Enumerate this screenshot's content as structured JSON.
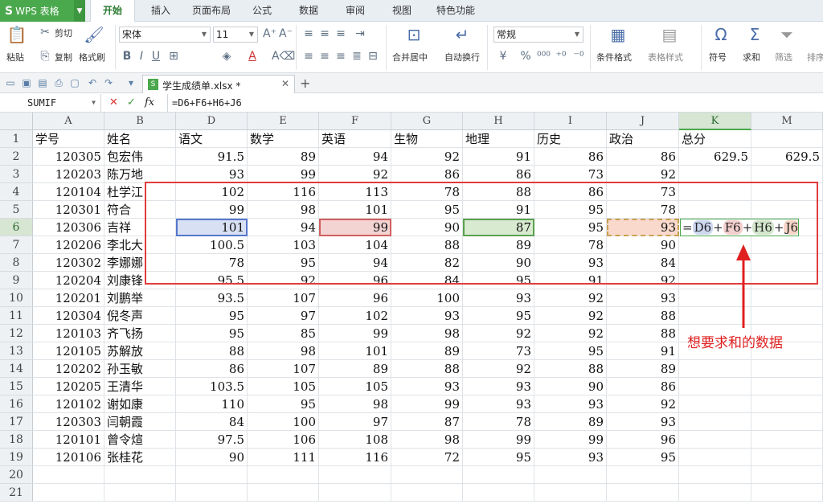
{
  "app": {
    "logo": "S",
    "name": "WPS 表格"
  },
  "menu_tabs": [
    "开始",
    "插入",
    "页面布局",
    "公式",
    "数据",
    "审阅",
    "视图",
    "特色功能"
  ],
  "ribbon": {
    "paste": "粘贴",
    "cut": "剪切",
    "copy": "复制",
    "format_painter": "格式刷",
    "font_name": "宋体",
    "font_size": "11",
    "merge_center": "合并居中",
    "wrap_text": "自动换行",
    "number_format": "常规",
    "conditional_format": "条件格式",
    "table_style": "表格样式",
    "symbol": "符号",
    "sum": "求和",
    "filter": "筛选",
    "sort": "排序"
  },
  "document": {
    "title": "学生成绩单.xlsx *"
  },
  "formula_bar": {
    "name_box": "SUMIF",
    "formula": "=D6+F6+H6+J6",
    "cancel": "✕",
    "confirm": "✓",
    "fx": "fx"
  },
  "columns": [
    "A",
    "B",
    "D",
    "E",
    "F",
    "G",
    "H",
    "I",
    "J",
    "K",
    "M"
  ],
  "selected_column": "K",
  "headers": [
    "学号",
    "姓名",
    "语文",
    "数学",
    "英语",
    "生物",
    "地理",
    "历史",
    "政治",
    "总分",
    ""
  ],
  "rows": [
    [
      "120305",
      "包宏伟",
      "91.5",
      "89",
      "94",
      "92",
      "91",
      "86",
      "86",
      "629.5",
      "629.5"
    ],
    [
      "120203",
      "陈万地",
      "93",
      "99",
      "92",
      "86",
      "86",
      "73",
      "92",
      "",
      ""
    ],
    [
      "120104",
      "杜学江",
      "102",
      "116",
      "113",
      "78",
      "88",
      "86",
      "73",
      "",
      ""
    ],
    [
      "120301",
      "符合",
      "99",
      "98",
      "101",
      "95",
      "91",
      "95",
      "78",
      "",
      ""
    ],
    [
      "120306",
      "吉祥",
      "101",
      "94",
      "99",
      "90",
      "87",
      "95",
      "93",
      "",
      ""
    ],
    [
      "120206",
      "李北大",
      "100.5",
      "103",
      "104",
      "88",
      "89",
      "78",
      "90",
      "",
      ""
    ],
    [
      "120302",
      "李娜娜",
      "78",
      "95",
      "94",
      "82",
      "90",
      "93",
      "84",
      "",
      ""
    ],
    [
      "120204",
      "刘康锋",
      "95.5",
      "92",
      "96",
      "84",
      "95",
      "91",
      "92",
      "",
      ""
    ],
    [
      "120201",
      "刘鹏举",
      "93.5",
      "107",
      "96",
      "100",
      "93",
      "92",
      "93",
      "",
      ""
    ],
    [
      "120304",
      "倪冬声",
      "95",
      "97",
      "102",
      "93",
      "95",
      "92",
      "88",
      "",
      ""
    ],
    [
      "120103",
      "齐飞扬",
      "95",
      "85",
      "99",
      "98",
      "92",
      "92",
      "88",
      "",
      ""
    ],
    [
      "120105",
      "苏解放",
      "88",
      "98",
      "101",
      "89",
      "73",
      "95",
      "91",
      "",
      ""
    ],
    [
      "120202",
      "孙玉敏",
      "86",
      "107",
      "89",
      "88",
      "92",
      "88",
      "89",
      "",
      ""
    ],
    [
      "120205",
      "王清华",
      "103.5",
      "105",
      "105",
      "93",
      "93",
      "90",
      "86",
      "",
      ""
    ],
    [
      "120102",
      "谢如康",
      "110",
      "95",
      "98",
      "99",
      "93",
      "93",
      "92",
      "",
      ""
    ],
    [
      "120303",
      "闫朝霞",
      "84",
      "100",
      "97",
      "87",
      "78",
      "89",
      "93",
      "",
      ""
    ],
    [
      "120101",
      "曾令煊",
      "97.5",
      "106",
      "108",
      "98",
      "99",
      "99",
      "96",
      "",
      ""
    ],
    [
      "120106",
      "张桂花",
      "90",
      "111",
      "116",
      "72",
      "95",
      "93",
      "95",
      "",
      ""
    ],
    [
      "",
      "",
      "",
      "",
      "",
      "",
      "",
      "",
      "",
      "",
      ""
    ],
    [
      "",
      "",
      "",
      "",
      "",
      "",
      "",
      "",
      "",
      "",
      ""
    ]
  ],
  "row_numbers": [
    "1",
    "2",
    "3",
    "4",
    "5",
    "6",
    "7",
    "8",
    "9",
    "10",
    "11",
    "12",
    "13",
    "14",
    "15",
    "16",
    "17",
    "18",
    "19",
    "20",
    "21"
  ],
  "edit_cell": {
    "eq": "=",
    "d6": "D6",
    "plus1": "+",
    "f6": "F6",
    "plus2": "+",
    "h6": "H6",
    "plus3": "+",
    "j6": "J6"
  },
  "annotation": "想要求和的数据",
  "colors": {
    "accent": "#4aa84d",
    "annotation": "#e02020"
  }
}
